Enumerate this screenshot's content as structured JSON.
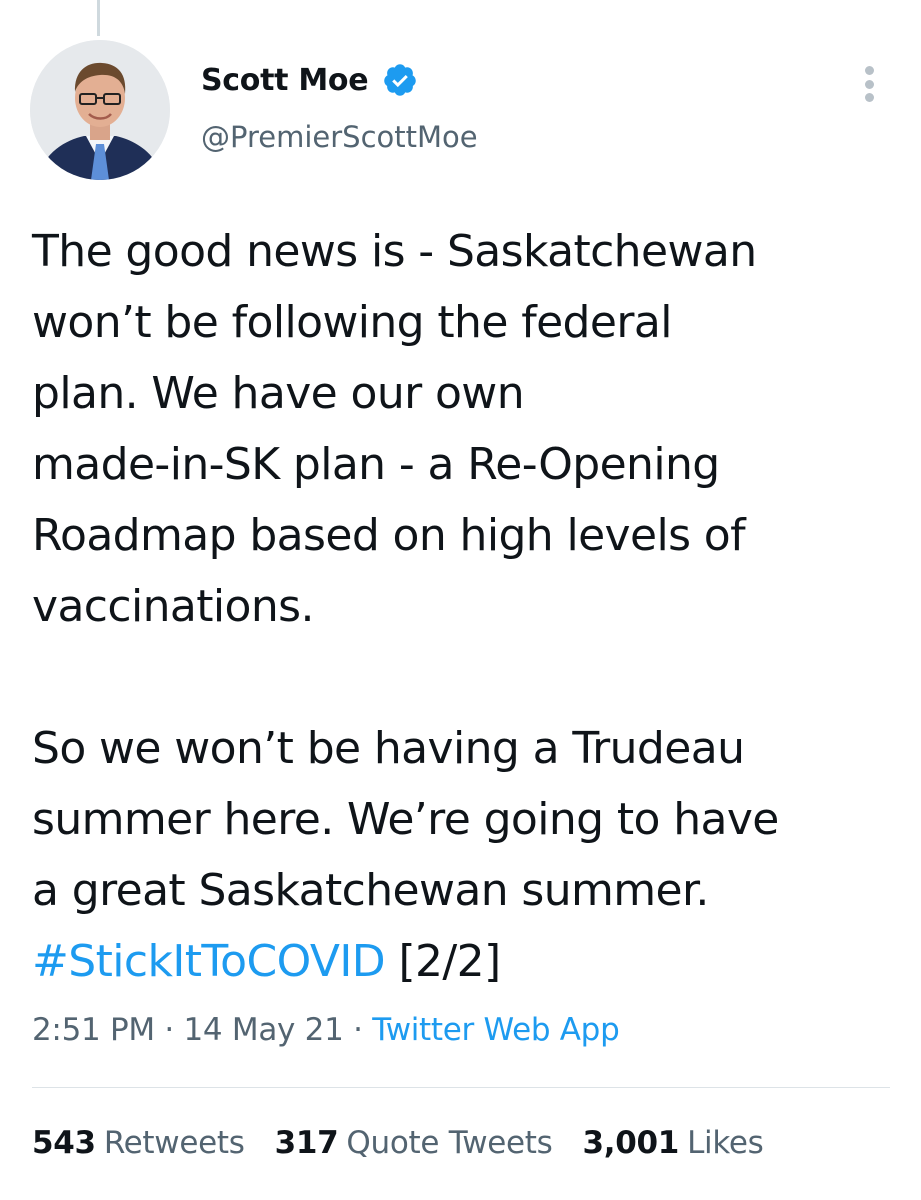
{
  "author": {
    "display_name": "Scott Moe",
    "handle": "@PremierScottMoe",
    "verified_icon": "verified-badge-icon",
    "avatar_icon": "profile-photo"
  },
  "tweet": {
    "lines_p1": [
      "The good news is - Saskatchewan",
      "won’t be following the federal",
      "plan. We have our own",
      "made-in-SK plan - a Re-Opening",
      "Roadmap based on high levels of",
      "vaccinations."
    ],
    "lines_p2": [
      "So we won’t be having a Trudeau",
      "summer here. We’re going to have",
      "a great Saskatchewan summer."
    ],
    "hashtag": "#StickItToCOVID",
    "thread_marker": "[2/2]"
  },
  "meta": {
    "time": "2:51 PM",
    "separator": "·",
    "date": "14 May 21",
    "source": "Twitter Web App"
  },
  "stats": {
    "retweets_count": "543",
    "retweets_label": "Retweets",
    "quotes_count": "317",
    "quotes_label": "Quote Tweets",
    "likes_count": "3,001",
    "likes_label": "Likes"
  },
  "colors": {
    "link": "#1d9bf0",
    "secondary_text": "#536471",
    "primary_text": "#0f1419"
  }
}
